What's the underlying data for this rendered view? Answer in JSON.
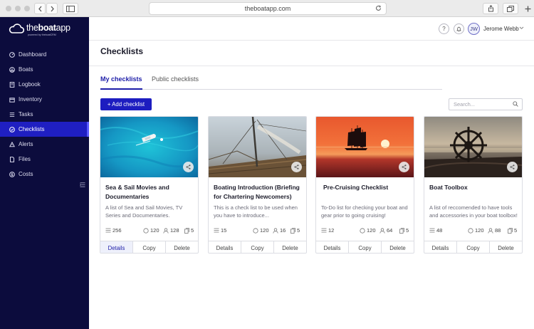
{
  "browser": {
    "url": "theboatapp.com"
  },
  "brand": {
    "logo_text_a": "the",
    "logo_text_b": "boat",
    "logo_text_c": "app",
    "logo_sub": "powered by theboatCRM"
  },
  "sidebar": {
    "items": [
      {
        "label": "Dashboard",
        "icon": "dashboard-icon"
      },
      {
        "label": "Boats",
        "icon": "boat-icon"
      },
      {
        "label": "Logbook",
        "icon": "logbook-icon"
      },
      {
        "label": "Inventory",
        "icon": "inventory-icon"
      },
      {
        "label": "Tasks",
        "icon": "tasks-icon"
      },
      {
        "label": "Checklists",
        "icon": "checklists-icon"
      },
      {
        "label": "Alerts",
        "icon": "alerts-icon"
      },
      {
        "label": "Files",
        "icon": "files-icon"
      },
      {
        "label": "Costs",
        "icon": "costs-icon"
      }
    ],
    "active_index": 5
  },
  "header": {
    "user_initials": "JW",
    "user_name": "Jerome Webb"
  },
  "page": {
    "title": "Checklists",
    "tabs": [
      "My checklists",
      "Public checklists"
    ],
    "add_button": "+ Add checklist",
    "search_placeholder": "Search..."
  },
  "cards": [
    {
      "title": "Sea & Sail Movies and Documentaries",
      "desc": "A list of Sea and Sail Movies, TV Series and Documentaries.",
      "items": "256",
      "views": "120",
      "followers": "128",
      "copies": "5",
      "actions": [
        "Details",
        "Copy",
        "Delete"
      ]
    },
    {
      "title": "Boating Introduction (Briefing for Chartering Newcomers)",
      "desc": "This is a check list to be used when you have to introduce...",
      "items": "15",
      "views": "120",
      "followers": "16",
      "copies": "5",
      "actions": [
        "Details",
        "Copy",
        "Delete"
      ]
    },
    {
      "title": "Pre-Cruising Checklist",
      "desc": "To-Do list for checking your boat and gear prior to going cruising!",
      "items": "12",
      "views": "120",
      "followers": "64",
      "copies": "5",
      "actions": [
        "Details",
        "Copy",
        "Delete"
      ]
    },
    {
      "title": "Boat Toolbox",
      "desc": "A list of reccomended to have tools and accessories in your boat toolbox!",
      "items": "48",
      "views": "120",
      "followers": "88",
      "copies": "5",
      "actions": [
        "Details",
        "Copy",
        "Delete"
      ]
    }
  ],
  "colors": {
    "sidebar_bg": "#0c0c3d",
    "accent": "#1d1dc0",
    "active_nav": "#1f1fc2"
  }
}
